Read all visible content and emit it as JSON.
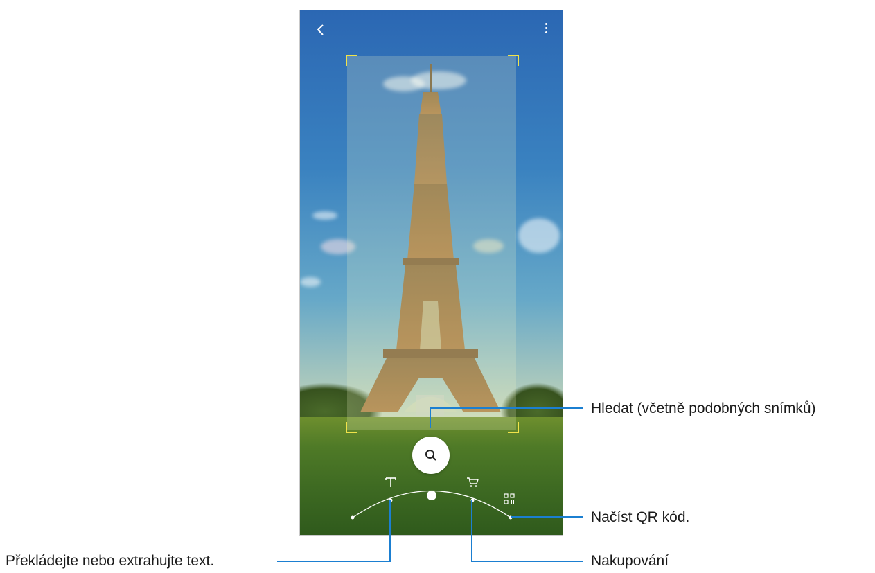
{
  "toolbar": {
    "back_icon": "chevron-left-icon",
    "more_icon": "more-vertical-icon"
  },
  "scanner": {
    "search_icon": "search-icon",
    "modes": [
      {
        "id": "text",
        "icon": "text-T-icon"
      },
      {
        "id": "shopping",
        "icon": "cart-icon"
      },
      {
        "id": "qr",
        "icon": "qr-code-icon"
      }
    ],
    "frame_color": "#f0e34a"
  },
  "callouts": {
    "search": "Hledat (včetně podobných snímků)",
    "qr": "Načíst QR kód.",
    "shopping": "Nakupování",
    "text": "Překládejte nebo extrahujte text."
  },
  "colors": {
    "callout_line": "#1b7fd1"
  }
}
